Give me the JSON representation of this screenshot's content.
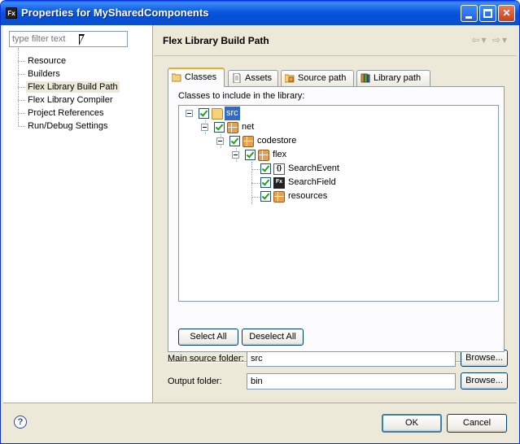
{
  "window": {
    "title": "Properties for MySharedComponents",
    "app_icon": "Fx"
  },
  "sidebar": {
    "filter_placeholder": "type filter text",
    "items": [
      {
        "label": "Resource"
      },
      {
        "label": "Builders"
      },
      {
        "label": "Flex Library Build Path",
        "selected": true
      },
      {
        "label": "Flex Library Compiler"
      },
      {
        "label": "Project References"
      },
      {
        "label": "Run/Debug Settings"
      }
    ]
  },
  "page": {
    "title": "Flex Library Build Path",
    "tabs": [
      {
        "label": "Classes",
        "icon": "folder-open-icon",
        "active": true
      },
      {
        "label": "Assets",
        "icon": "document-icon"
      },
      {
        "label": "Source path",
        "icon": "source-folder-icon"
      },
      {
        "label": "Library path",
        "icon": "library-icon"
      }
    ],
    "classes_label": "Classes to include in the library:",
    "tree": [
      {
        "label": "src",
        "icon": "folder-icon",
        "checked": true,
        "selected": true
      },
      {
        "label": "net",
        "icon": "package-icon",
        "checked": true
      },
      {
        "label": "codestore",
        "icon": "package-icon",
        "checked": true
      },
      {
        "label": "flex",
        "icon": "package-icon",
        "checked": true
      },
      {
        "label": "SearchEvent",
        "icon": "actionscript-file-icon",
        "checked": true
      },
      {
        "label": "SearchField",
        "icon": "mxml-file-icon",
        "checked": true
      },
      {
        "label": "resources",
        "icon": "package-icon",
        "checked": true
      }
    ],
    "select_all": "Select All",
    "deselect_all": "Deselect All",
    "main_source_label": "Main source folder:",
    "main_source_value": "src",
    "output_label": "Output folder:",
    "output_value": "bin",
    "browse": "Browse..."
  },
  "footer": {
    "ok": "OK",
    "cancel": "Cancel"
  }
}
